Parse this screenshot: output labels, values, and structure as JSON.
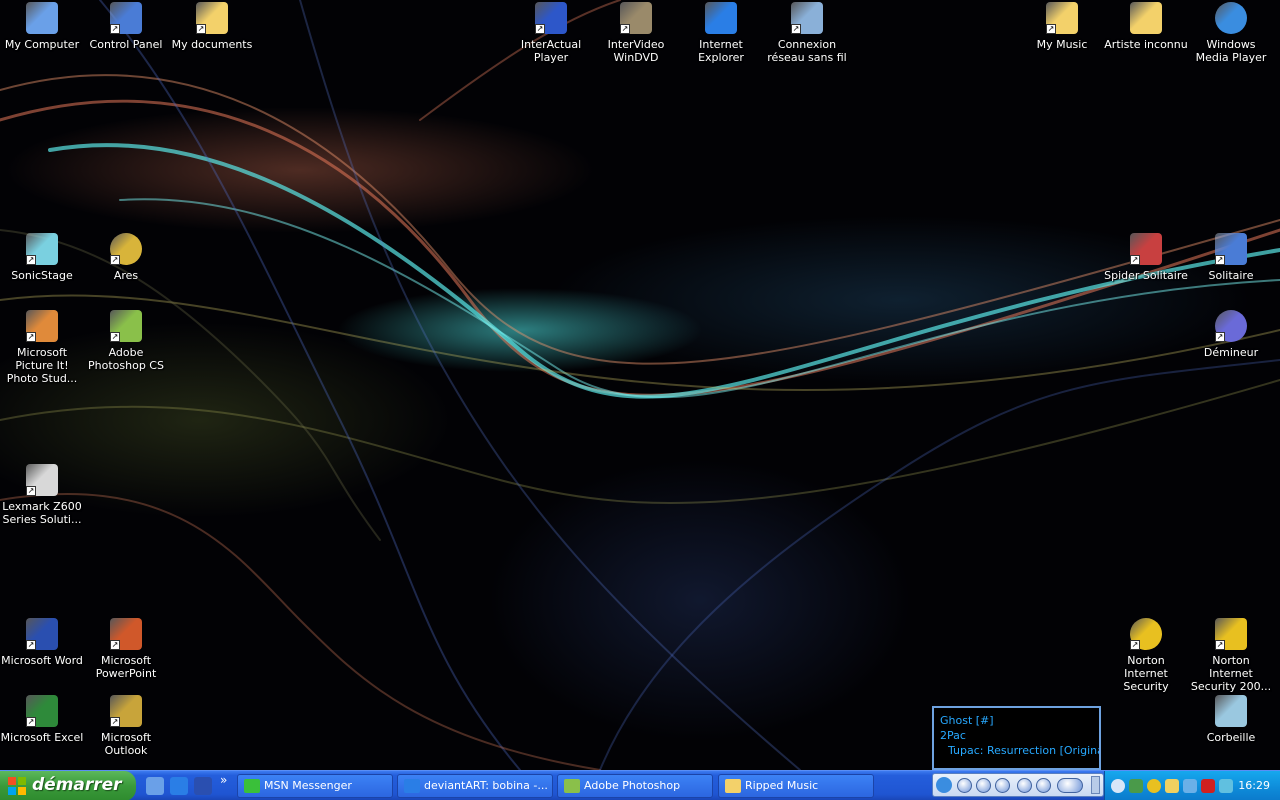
{
  "desktop_icons": [
    {
      "id": "my-computer",
      "label": "My Computer",
      "icon": "computer-icon",
      "color": "#6aa0e8"
    },
    {
      "id": "control-panel",
      "label": "Control Panel",
      "icon": "control-panel-icon",
      "color": "#4a7cd6"
    },
    {
      "id": "my-documents",
      "label": "My documents",
      "icon": "folder-icon",
      "color": "#f3d16a"
    },
    {
      "id": "interactual-player",
      "label": "InterActual Player",
      "icon": "interactual-icon",
      "color": "#2d57c9"
    },
    {
      "id": "intervideo-windvd",
      "label": "InterVideo WinDVD",
      "icon": "dvd-icon",
      "color": "#9a8a6a"
    },
    {
      "id": "internet-explorer",
      "label": "Internet Explorer",
      "icon": "ie-icon",
      "color": "#2a7ee6"
    },
    {
      "id": "connexion-reseau",
      "label": "Connexion réseau sans fil",
      "icon": "wireless-network-icon",
      "color": "#8ab0d8"
    },
    {
      "id": "my-music",
      "label": "My Music",
      "icon": "music-folder-icon",
      "color": "#f3d16a"
    },
    {
      "id": "artiste-inconnu",
      "label": "Artiste inconnu",
      "icon": "folder-icon",
      "color": "#f3d16a"
    },
    {
      "id": "windows-media-player",
      "label": "Windows Media Player",
      "icon": "media-player-icon",
      "color": "#3a8de0"
    },
    {
      "id": "sonicstage",
      "label": "SonicStage",
      "icon": "sonicstage-icon",
      "color": "#7ad0e0"
    },
    {
      "id": "ares",
      "label": "Ares",
      "icon": "ares-icon",
      "color": "#d8b43a"
    },
    {
      "id": "spider-solitaire",
      "label": "Spider Solitaire",
      "icon": "spider-solitaire-icon",
      "color": "#c84040"
    },
    {
      "id": "solitaire",
      "label": "Solitaire",
      "icon": "solitaire-icon",
      "color": "#4a7cd6"
    },
    {
      "id": "ms-picture-it",
      "label": "Microsoft Picture It! Photo Stud...",
      "icon": "picture-it-icon",
      "color": "#e08a3a"
    },
    {
      "id": "adobe-photoshop-cs",
      "label": "Adobe Photoshop CS",
      "icon": "photoshop-icon",
      "color": "#8ac04a"
    },
    {
      "id": "demineur",
      "label": "Démineur",
      "icon": "minesweeper-icon",
      "color": "#6a6ad8"
    },
    {
      "id": "lexmark",
      "label": "Lexmark Z600 Series Soluti...",
      "icon": "printer-icon",
      "color": "#d8d8d8"
    },
    {
      "id": "ms-word",
      "label": "Microsoft Word",
      "icon": "word-icon",
      "color": "#2a4fb0"
    },
    {
      "id": "ms-powerpoint",
      "label": "Microsoft PowerPoint",
      "icon": "powerpoint-icon",
      "color": "#d0582a"
    },
    {
      "id": "norton-internet-security",
      "label": "Norton Internet Security",
      "icon": "norton-icon",
      "color": "#e8c020"
    },
    {
      "id": "norton-internet-security-200",
      "label": "Norton Internet Security 200...",
      "icon": "norton-key-icon",
      "color": "#e8c020"
    },
    {
      "id": "ms-excel",
      "label": "Microsoft Excel",
      "icon": "excel-icon",
      "color": "#2e8a3a"
    },
    {
      "id": "ms-outlook",
      "label": "Microsoft Outlook",
      "icon": "outlook-icon",
      "color": "#c8a43a"
    },
    {
      "id": "corbeille",
      "label": "Corbeille",
      "icon": "recycle-bin-icon",
      "color": "#9ac8e0"
    }
  ],
  "taskbar": {
    "start_label": "démarrer",
    "quick_launch": [
      {
        "icon": "show-desktop-icon",
        "color": "#6aa0e8"
      },
      {
        "icon": "ie-icon",
        "color": "#2a7ee6"
      },
      {
        "icon": "word-icon",
        "color": "#2a4fb0"
      }
    ],
    "overflow_label": "»",
    "tasks": [
      {
        "label": "MSN Messenger",
        "icon": "msn-icon",
        "color": "#3ac03a"
      },
      {
        "label": "deviantART: bobina -...",
        "icon": "ie-icon",
        "color": "#2a7ee6"
      },
      {
        "label": "Adobe Photoshop",
        "icon": "photoshop-icon",
        "color": "#8ac04a"
      },
      {
        "label": "Ripped Music",
        "icon": "folder-icon",
        "color": "#f3d16a"
      }
    ],
    "clock": "16:29"
  },
  "now_playing": {
    "track": "Ghost [#]",
    "artist": "2Pac",
    "album": "Tupac: Resurrection [Original S"
  }
}
